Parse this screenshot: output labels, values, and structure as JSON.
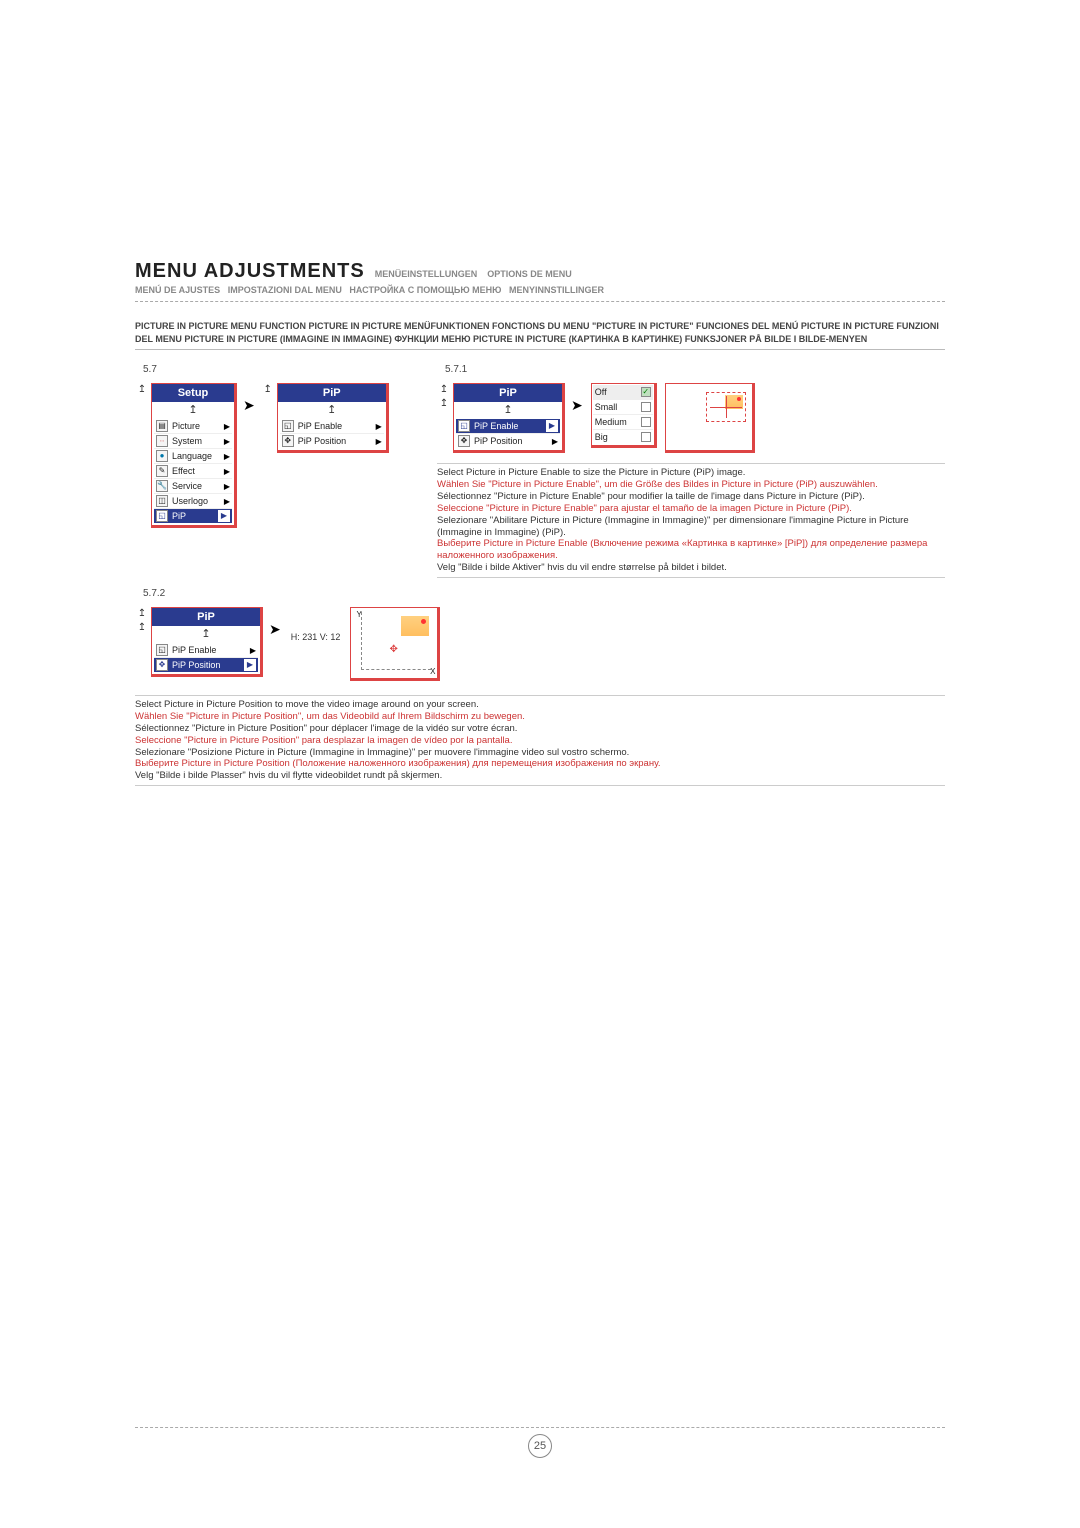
{
  "title": {
    "main": "MENU ADJUSTMENTS",
    "de": "MENÜEINSTELLUNGEN",
    "fr": "OPTIONS DE MENU",
    "es": "MENÚ DE AJUSTES",
    "it": "IMPOSTAZIONI DAL MENU",
    "ru": "НАСТРОЙКА С ПОМОЩЬЮ МЕНЮ",
    "no": "MENYINNSTILLINGER"
  },
  "section_heading": "PICTURE IN PICTURE MENU FUNCTION     PICTURE IN PICTURE MENÜFUNKTIONEN     FONCTIONS DU MENU \"PICTURE IN PICTURE\"     FUNCIONES DEL MENÚ PICTURE IN PICTURE     FUNZIONI DEL MENU PICTURE IN PICTURE (IMMAGINE IN IMMAGINE)     ФУНКЦИИ МЕНЮ PICTURE IN PICTURE (КАРТИНКА В КАРТИНКЕ)     FUNKSJONER PÅ BILDE I BILDE-MENYEN",
  "sec57": "5.7",
  "sec571": "5.7.1",
  "sec572": "5.7.2",
  "setup_menu": {
    "title": "Setup",
    "items": [
      {
        "label": "Picture"
      },
      {
        "label": "System"
      },
      {
        "label": "Language"
      },
      {
        "label": "Effect"
      },
      {
        "label": "Service"
      },
      {
        "label": "Userlogo"
      },
      {
        "label": "PiP",
        "selected": true
      }
    ]
  },
  "pip_menu_title": "PiP",
  "pip_menu_items": [
    {
      "label": "PiP Enable"
    },
    {
      "label": "PiP Position"
    }
  ],
  "pip_menu_selected_enable": 0,
  "pip_menu_selected_position": 1,
  "enable_options": [
    {
      "label": "Off",
      "checked": true
    },
    {
      "label": "Small"
    },
    {
      "label": "Medium"
    },
    {
      "label": "Big"
    }
  ],
  "position_readout": "H: 231   V: 12",
  "axis": {
    "x": "X",
    "y": "Y"
  },
  "desc_enable": {
    "en": "Select Picture in Picture Enable to size the Picture in Picture (PiP) image.",
    "de": "Wählen Sie \"Picture in Picture Enable\", um die Größe des Bildes in Picture in Picture (PiP) auszuwählen.",
    "fr": "Sélectionnez \"Picture in Picture Enable\" pour modifier la taille de l'image dans Picture in Picture (PiP).",
    "es": "Seleccione \"Picture in Picture Enable\" para ajustar el tamaño de la imagen Picture in Picture (PiP).",
    "it": "Selezionare \"Abilitare Picture in Picture (Immagine in Immagine)\" per dimensionare l'immagine Picture in Picture (Immagine in Immagine) (PiP).",
    "ru": "Выберите Picture in Picture Enable (Включение режима «Картинка в картинке» [PiP]) для определение размера наложенного изображения.",
    "no": "Velg \"Bilde i bilde Aktiver\" hvis du vil endre størrelse på bildet i bildet."
  },
  "desc_position": {
    "en": "Select Picture in Picture Position to move the video image around on your screen.",
    "de": "Wählen Sie \"Picture in Picture Position\", um das Videobild auf Ihrem Bildschirm zu bewegen.",
    "fr": "Sélectionnez \"Picture in Picture Position\" pour déplacer l'image de la vidéo sur votre écran.",
    "es": "Seleccione \"Picture in Picture Position\" para desplazar la imagen de vídeo por la pantalla.",
    "it": "Selezionare \"Posizione Picture in Picture (Immagine in Immagine)\" per muovere l'immagine video sul vostro schermo.",
    "ru": "Выберите Picture in Picture Position (Положение наложенного изображения) для перемещения изображения по экрану.",
    "no": "Velg \"Bilde i bilde Plasser\" hvis du vil flytte videobildet rundt på skjermen."
  },
  "page_number": "25"
}
